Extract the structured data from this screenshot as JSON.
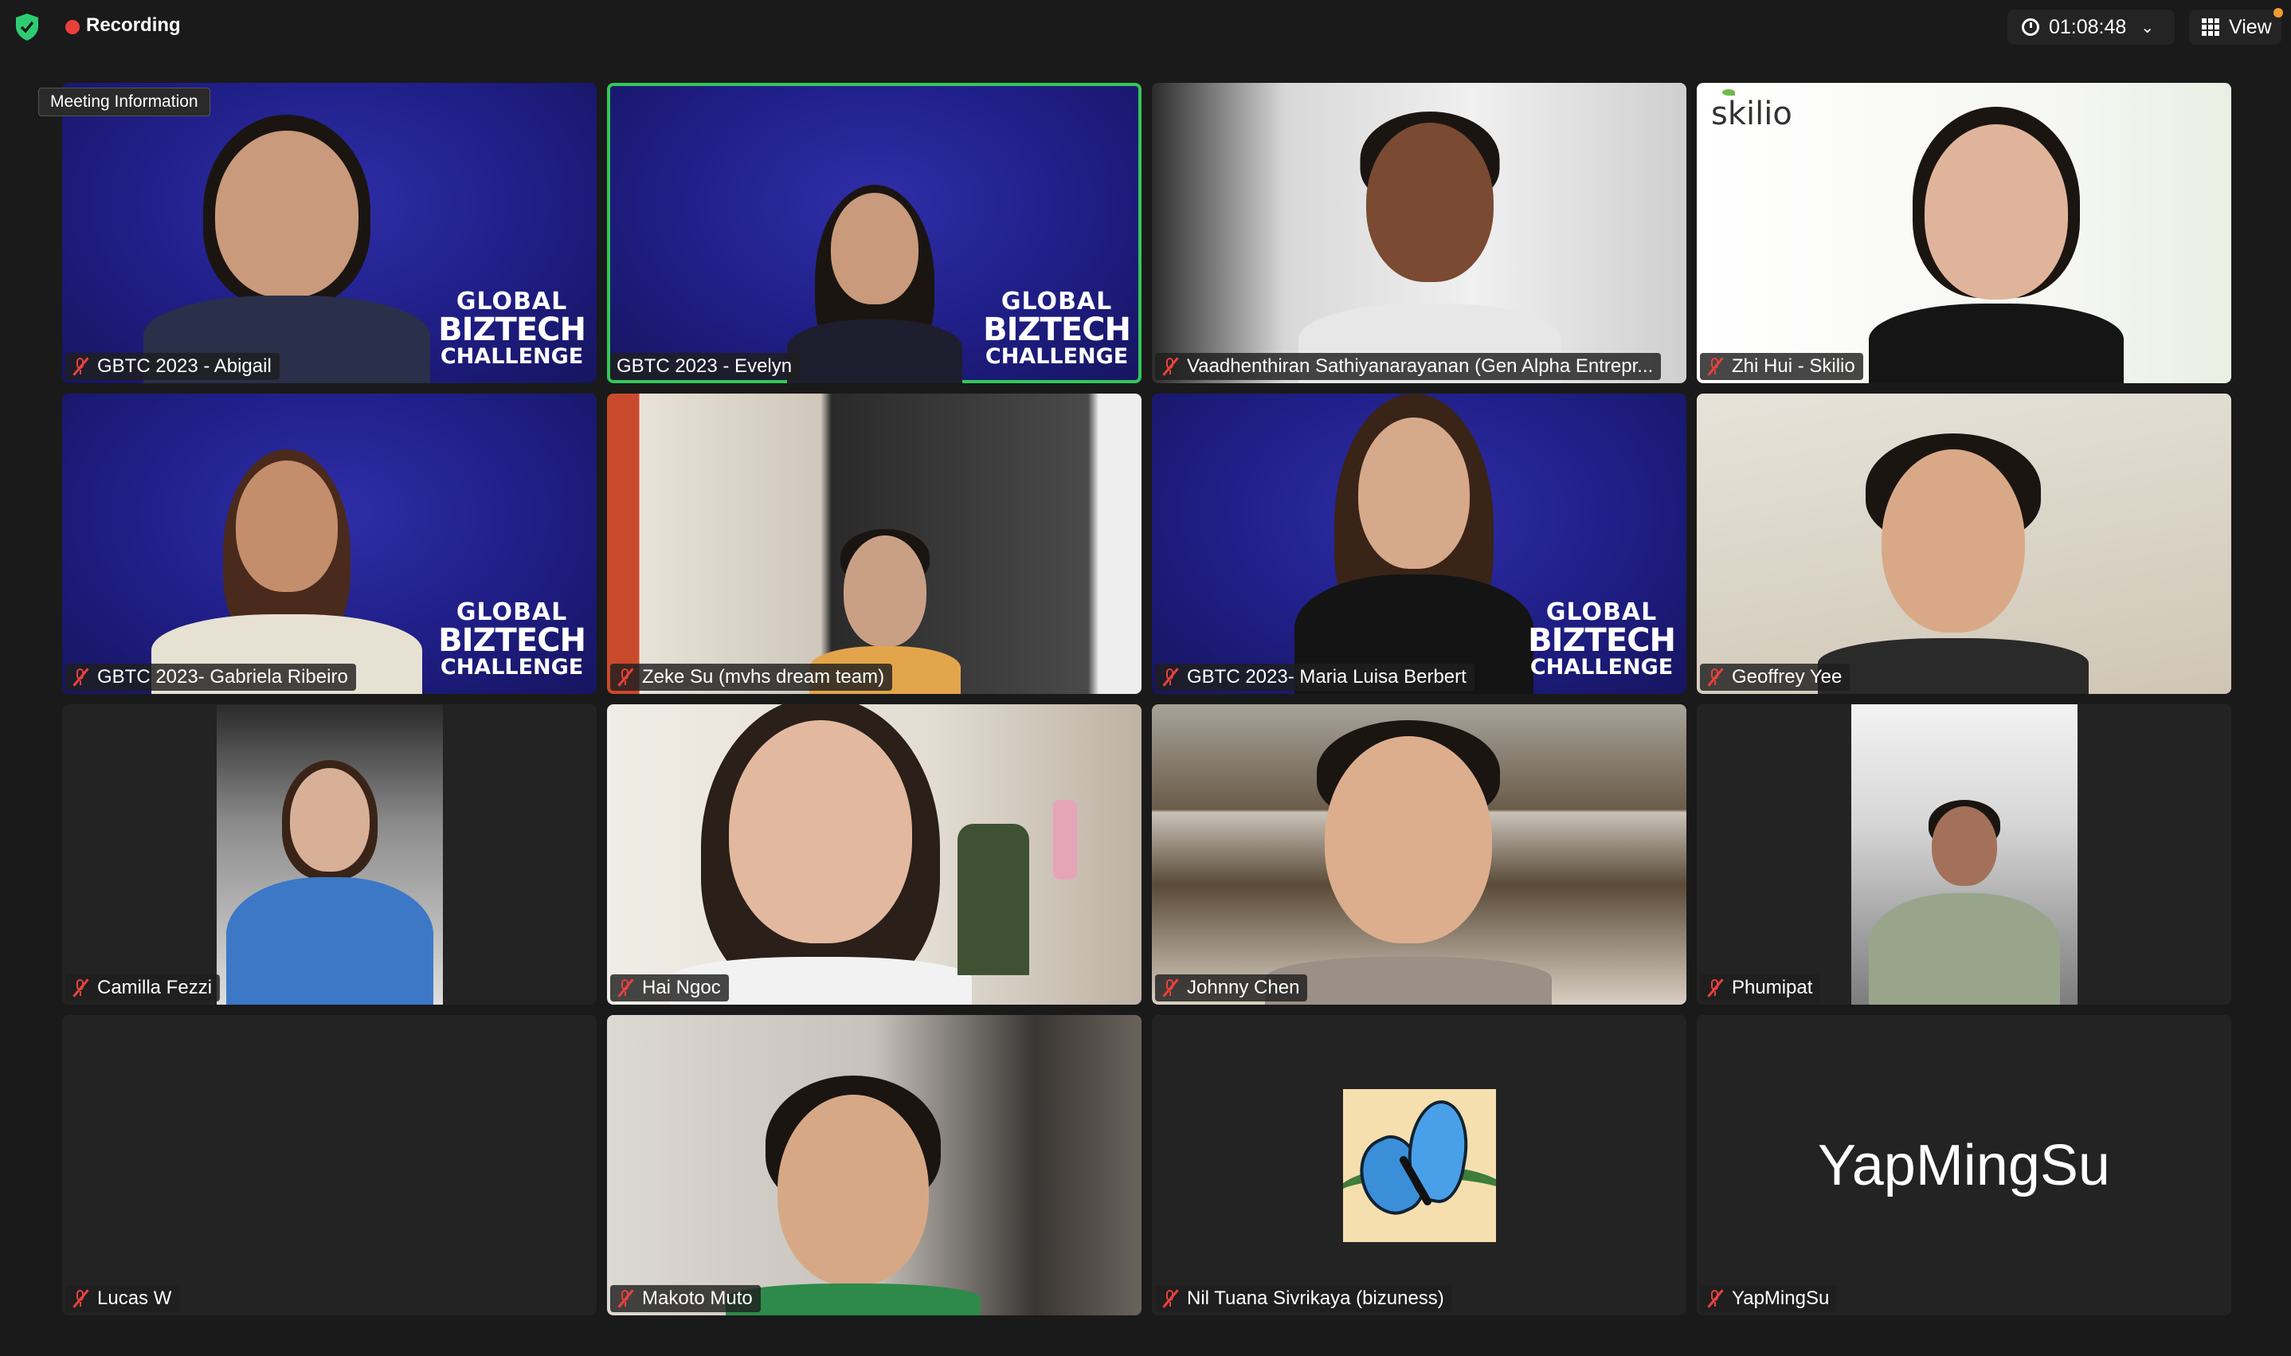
{
  "topbar": {
    "recording_label": "Recording",
    "timer": "01:08:48",
    "view_label": "View"
  },
  "meeting_info_label": "Meeting Information",
  "participants": [
    {
      "name": "GBTC 2023 - Abigail",
      "muted": true,
      "background": "biztech"
    },
    {
      "name": "GBTC 2023 - Evelyn",
      "muted": false,
      "background": "biztech",
      "speaking": true
    },
    {
      "name": "Vaadhenthiran Sathiyanarayanan (Gen Alpha Entrepr...",
      "muted": true,
      "background": "room"
    },
    {
      "name": "Zhi Hui - Skilio",
      "muted": true,
      "background": "skilio"
    },
    {
      "name": "GBTC 2023- Gabriela Ribeiro",
      "muted": true,
      "background": "biztech"
    },
    {
      "name": "Zeke Su (mvhs dream team)",
      "muted": true,
      "background": "room"
    },
    {
      "name": "GBTC 2023- Maria Luisa Berbert",
      "muted": true,
      "background": "biztech"
    },
    {
      "name": "Geoffrey Yee",
      "muted": true,
      "background": "room"
    },
    {
      "name": "Camilla Fezzi",
      "muted": true,
      "background": "car"
    },
    {
      "name": "Hai Ngoc",
      "muted": true,
      "background": "room"
    },
    {
      "name": "Johnny Chen",
      "muted": true,
      "background": "room"
    },
    {
      "name": "Phumipat",
      "muted": true,
      "background": "room"
    },
    {
      "name": "Lucas W",
      "muted": true,
      "background": "video-off"
    },
    {
      "name": "Makoto Muto",
      "muted": true,
      "background": "room"
    },
    {
      "name": "Nil Tuana Sivrikaya (bizuness)",
      "muted": true,
      "background": "avatar-butterfly"
    },
    {
      "name": "YapMingSu",
      "muted": true,
      "background": "name-only",
      "display_name": "YapMingSu"
    }
  ],
  "logos": {
    "biztech_line1": "GLOBAL",
    "biztech_line2": "BIZTECH",
    "biztech_line3": "CHALLENGE",
    "skilio": "skilio"
  },
  "colors": {
    "active_speaker_border": "#34c759",
    "mute_red": "#e8413c",
    "recording_dot": "#e8413c",
    "security_shield": "#2ecc71",
    "biztech_blue": "#1f1e86"
  }
}
